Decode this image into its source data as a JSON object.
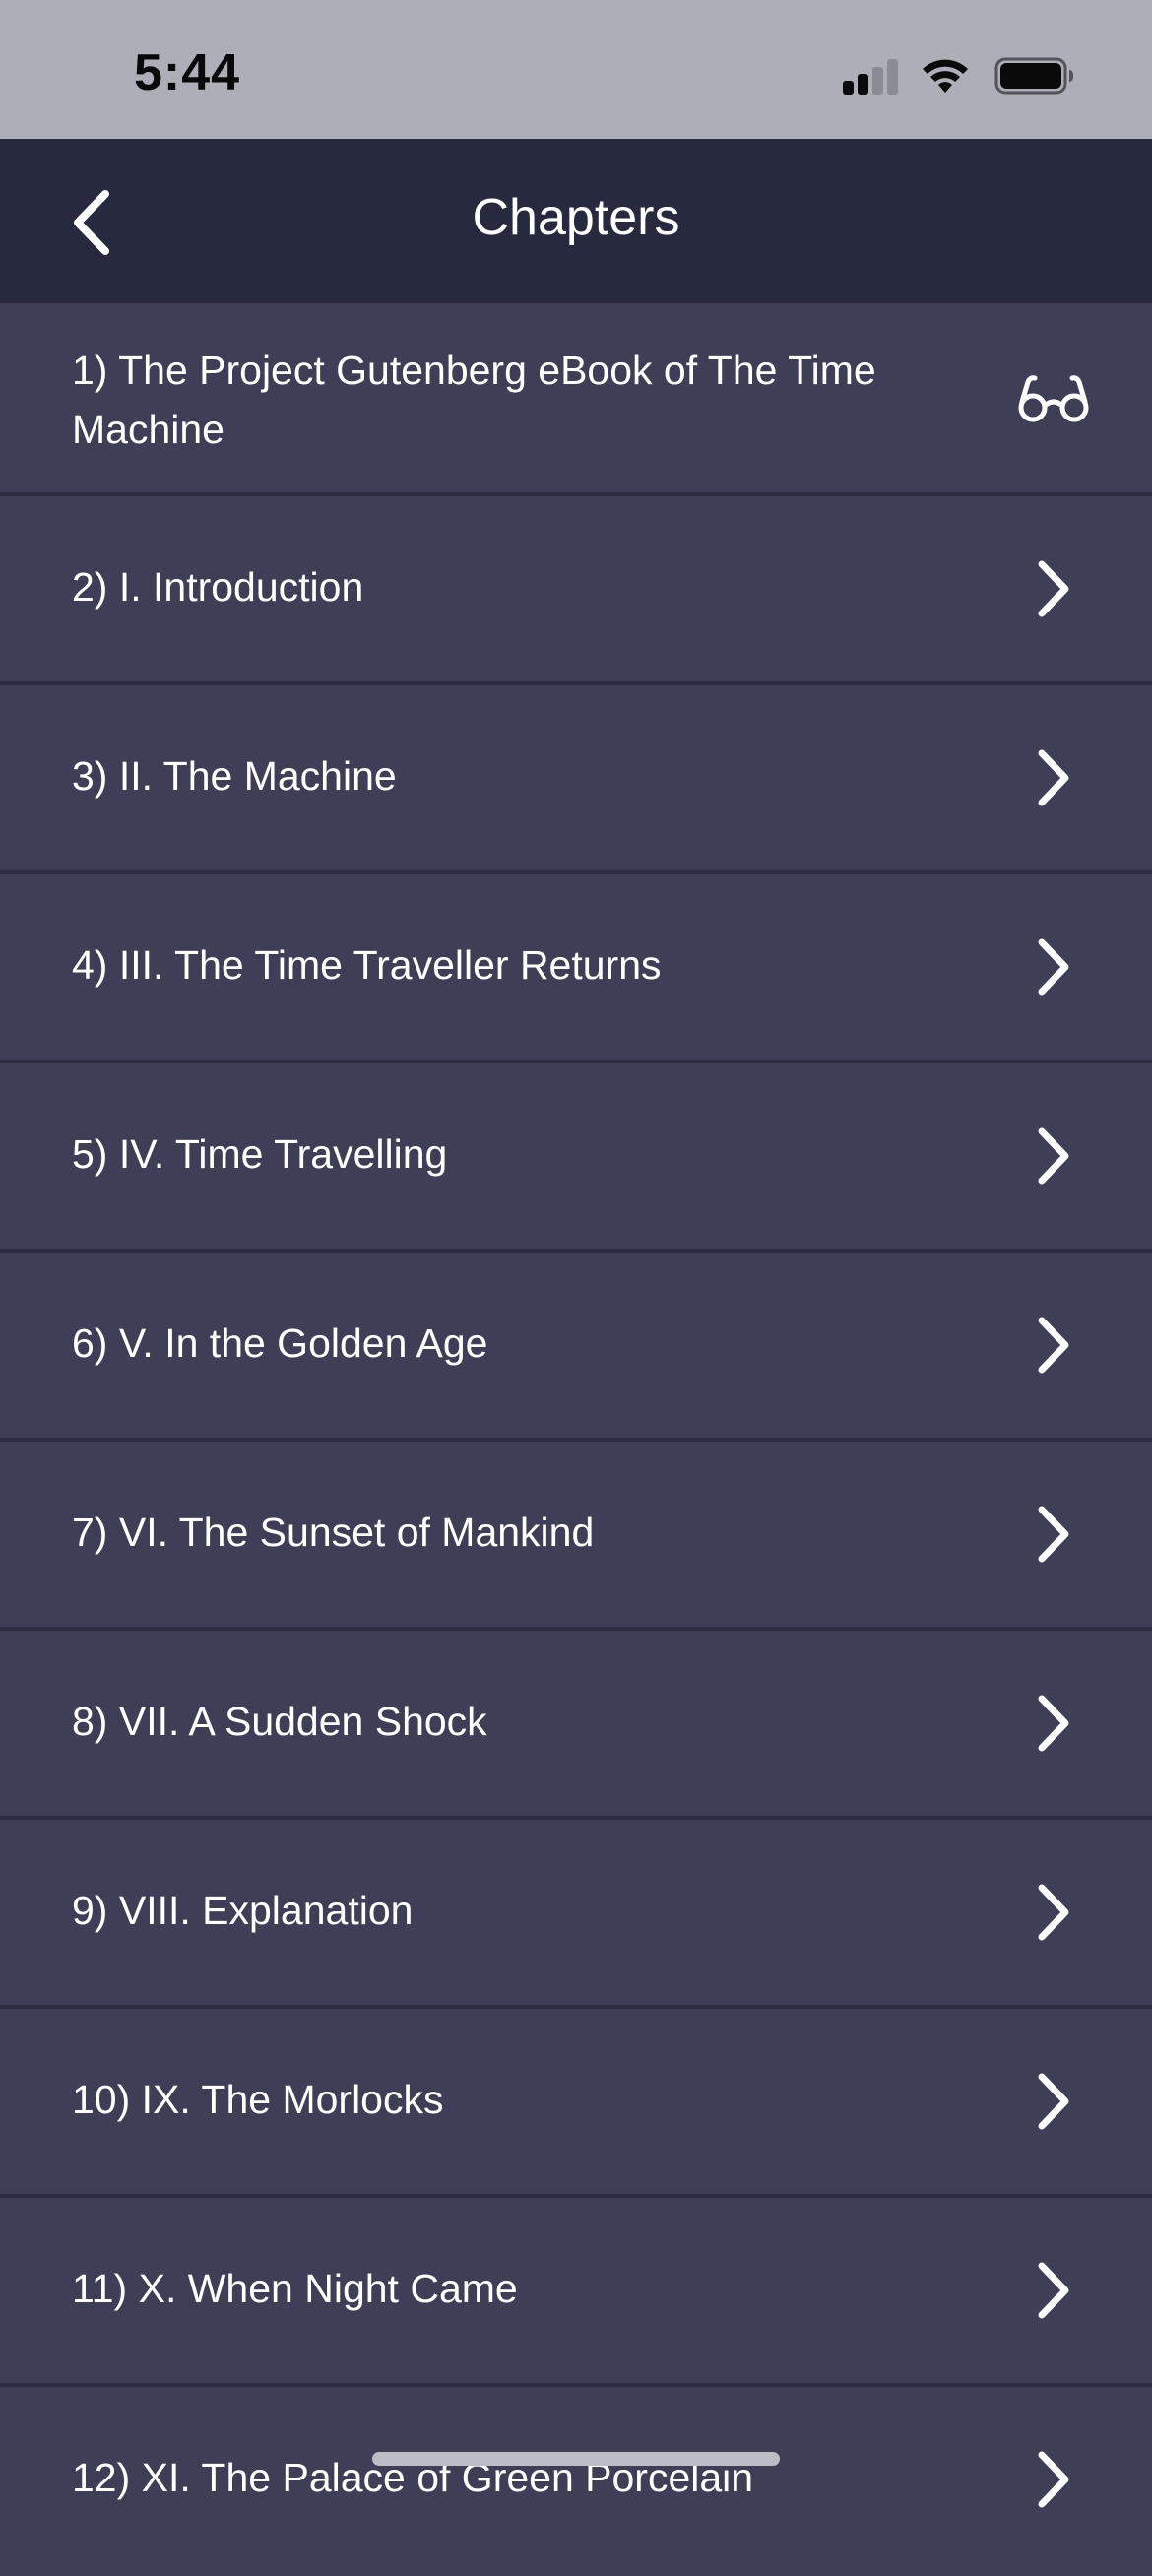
{
  "status_bar": {
    "time": "5:44"
  },
  "nav": {
    "title": "Chapters",
    "back_icon": "chevron-left-icon"
  },
  "chapters": [
    {
      "label": "1) The Project Gutenberg eBook of The Time Machine",
      "icon": "reading-glasses-icon"
    },
    {
      "label": "2) I. Introduction",
      "icon": "chevron-right-icon"
    },
    {
      "label": "3) II. The Machine",
      "icon": "chevron-right-icon"
    },
    {
      "label": "4) III. The Time Traveller Returns",
      "icon": "chevron-right-icon"
    },
    {
      "label": "5) IV. Time Travelling",
      "icon": "chevron-right-icon"
    },
    {
      "label": "6) V. In the Golden Age",
      "icon": "chevron-right-icon"
    },
    {
      "label": "7) VI. The Sunset of Mankind",
      "icon": "chevron-right-icon"
    },
    {
      "label": "8) VII. A Sudden Shock",
      "icon": "chevron-right-icon"
    },
    {
      "label": "9) VIII. Explanation",
      "icon": "chevron-right-icon"
    },
    {
      "label": "10) IX. The Morlocks",
      "icon": "chevron-right-icon"
    },
    {
      "label": "11) X. When Night Came",
      "icon": "chevron-right-icon"
    },
    {
      "label": "12) XI. The Palace of Green Porcelain",
      "icon": "chevron-right-icon"
    }
  ],
  "colors": {
    "status_bar_bg": "#aeaeb8",
    "nav_bg": "#272a3f",
    "row_bg": "#3e3f56",
    "row_divider": "#2a2c40",
    "text": "#ffffff"
  }
}
